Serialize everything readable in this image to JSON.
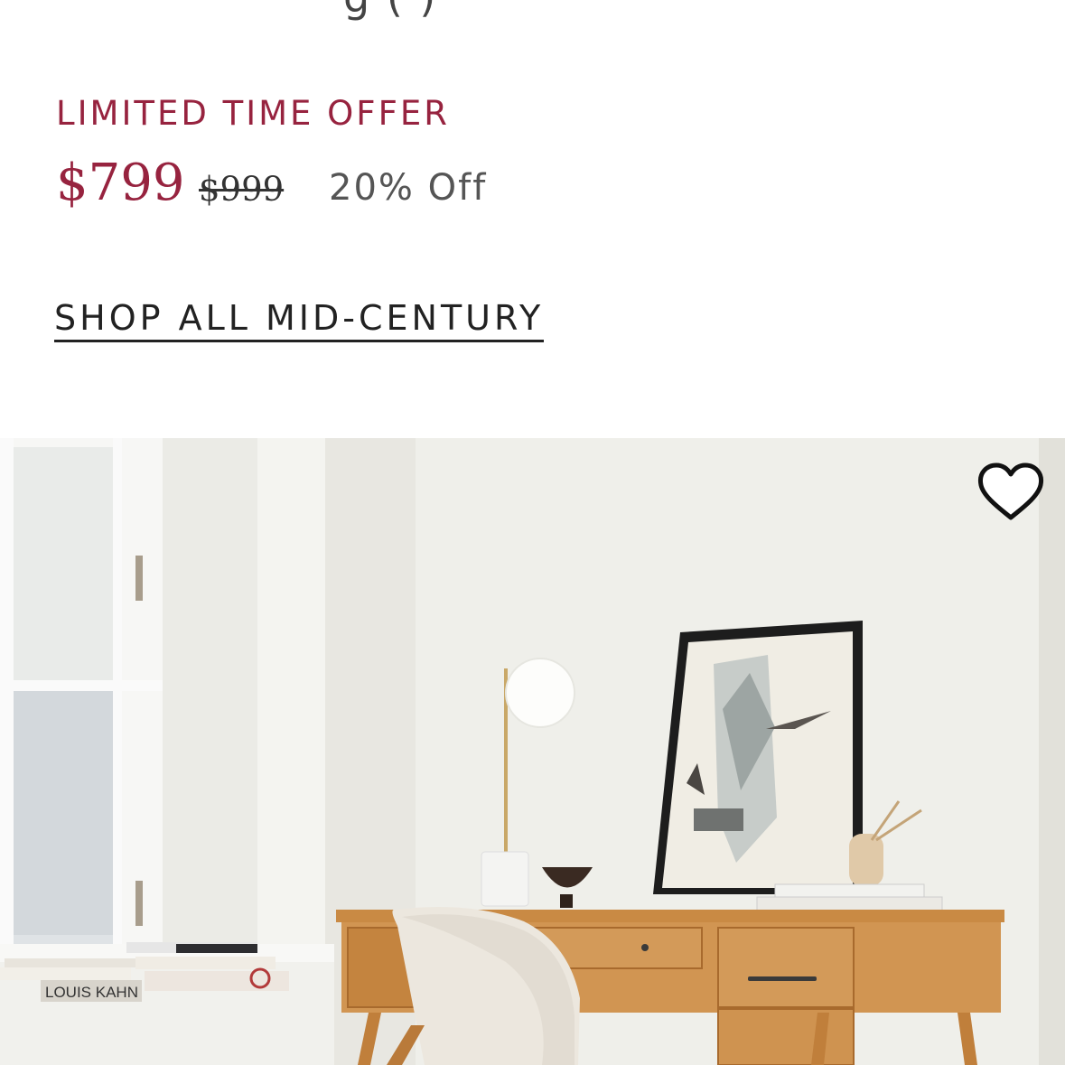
{
  "header": {
    "cut_text": "g (   )"
  },
  "offer": {
    "label": "LIMITED TIME OFFER",
    "price_current": "$799",
    "price_original": "$999",
    "discount": "20% Off"
  },
  "shop_link": {
    "label": "SHOP ALL MID-CENTURY"
  },
  "hero": {
    "favorite_icon": "heart-outline-icon",
    "book_spine_label": "LOUIS KAHN",
    "colors": {
      "accent": "#97233f",
      "wood": "#c98a44",
      "wall": "#efefea"
    }
  }
}
